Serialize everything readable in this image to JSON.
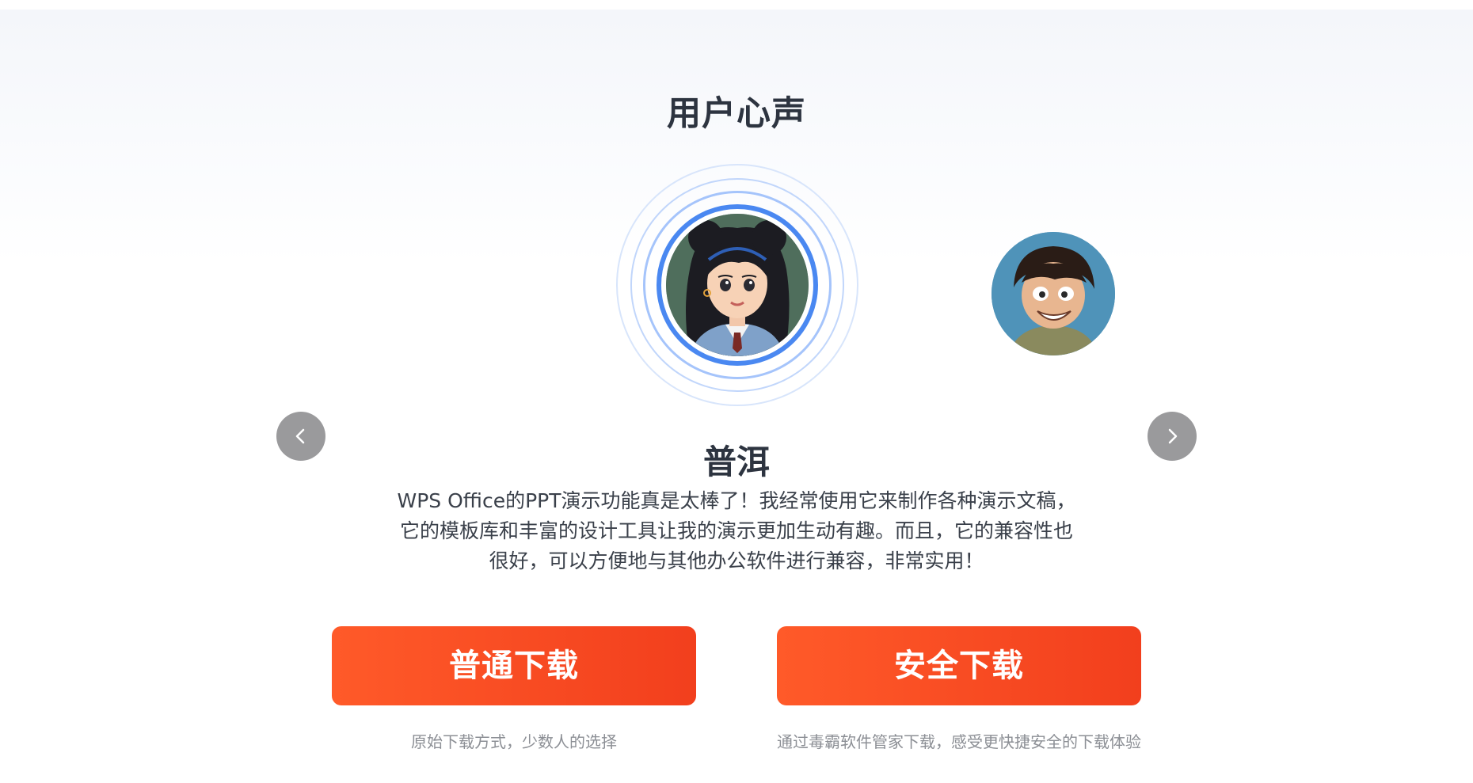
{
  "section": {
    "title": "用户心声"
  },
  "carousel": {
    "active_user": {
      "name": "普洱",
      "quote": "WPS Office的PPT演示功能真是太棒了！我经常使用它来制作各种演示文稿，它的模板库和丰富的设计工具让我的演示更加生动有趣。而且，它的兼容性也很好，可以方便地与其他办公软件进行兼容，非常实用！",
      "avatar_icon": "girl-avatar-icon"
    },
    "next_user": {
      "avatar_icon": "boy-avatar-icon"
    },
    "prev_icon": "chevron-left-icon",
    "next_icon": "chevron-right-icon"
  },
  "downloads": {
    "normal": {
      "label": "普通下载",
      "note": "原始下载方式，少数人的选择"
    },
    "safe": {
      "label": "安全下载",
      "note": "通过毒霸软件管家下载，感受更快捷安全的下载体验"
    }
  },
  "colors": {
    "accent_blue": "#4a88f1",
    "button_orange": "#ff5a29",
    "button_red": "#f23f1d",
    "nav_gray": "#9a9a9c"
  }
}
